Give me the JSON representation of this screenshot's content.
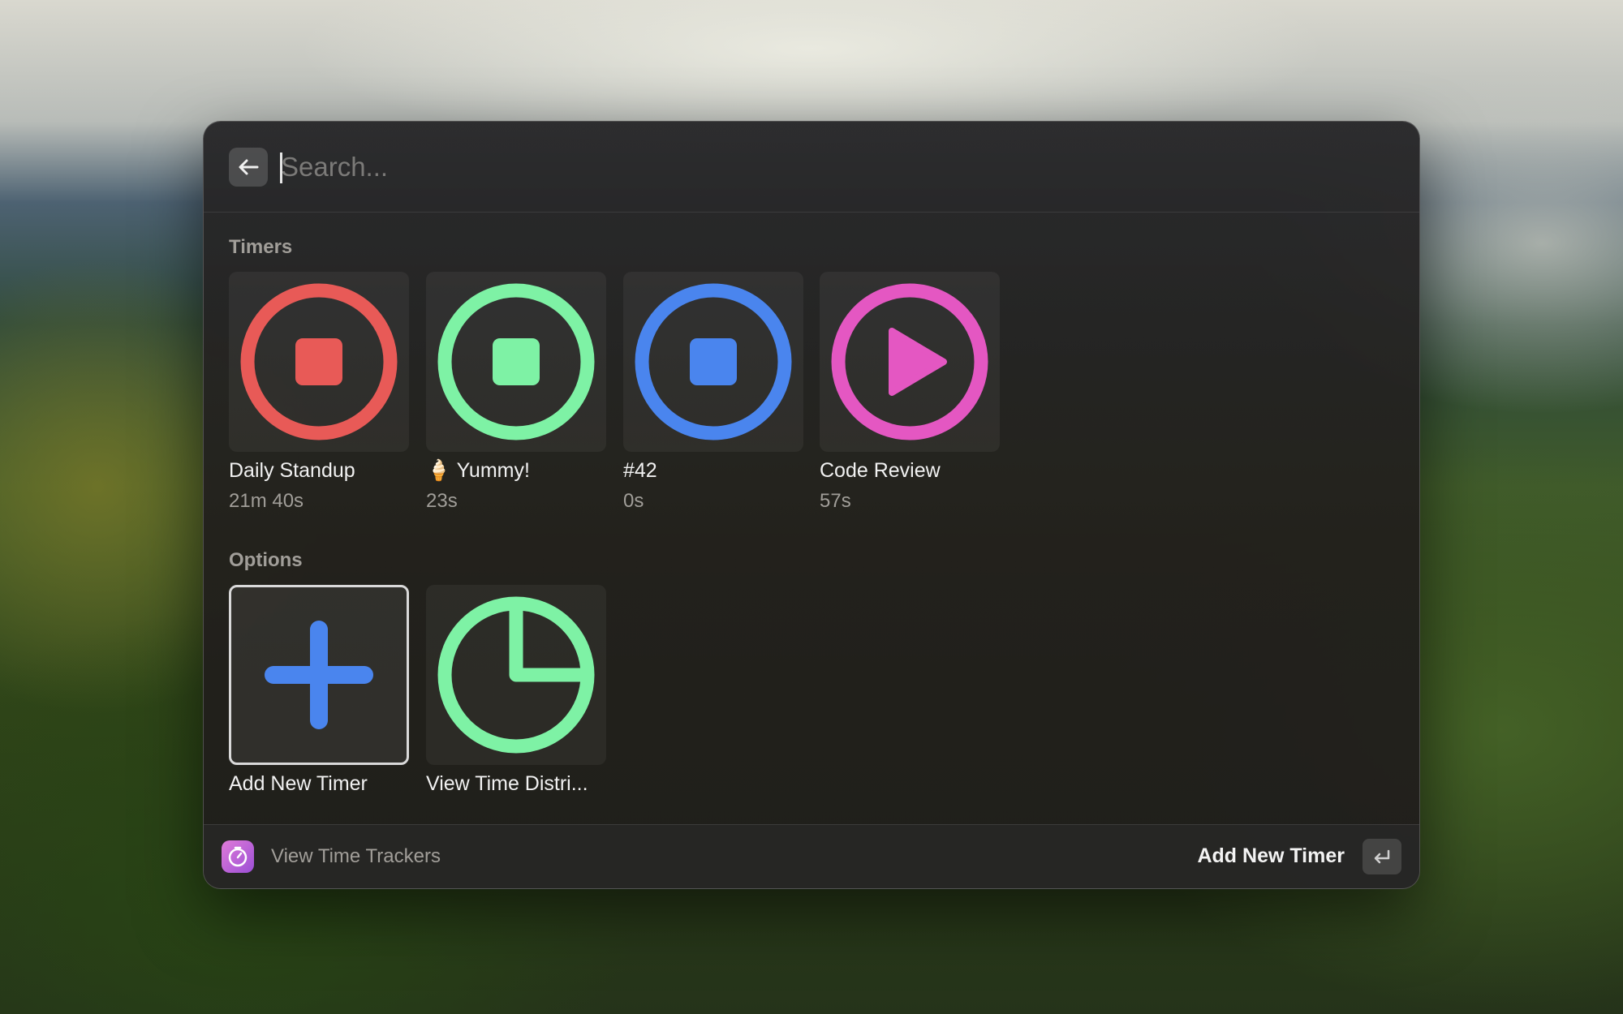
{
  "search": {
    "placeholder": "Search..."
  },
  "sections": {
    "timers_title": "Timers",
    "options_title": "Options"
  },
  "timers": [
    {
      "name": "Daily Standup",
      "elapsed": "21m 40s",
      "color": "#e85a57",
      "state": "stop-icon"
    },
    {
      "name": "🍦 Yummy!",
      "elapsed": "23s",
      "color": "#7ef2a5",
      "state": "stop-icon"
    },
    {
      "name": "#42",
      "elapsed": "0s",
      "color": "#4a85ee",
      "state": "stop-icon"
    },
    {
      "name": "Code Review",
      "elapsed": "57s",
      "color": "#e457c2",
      "state": "play-icon"
    }
  ],
  "options": [
    {
      "name": "Add New Timer",
      "icon": "plus-icon",
      "color": "#4a85ee",
      "selected": true
    },
    {
      "name": "View Time Distri...",
      "icon": "pie-chart-icon",
      "color": "#7ef2a5",
      "selected": false
    }
  ],
  "footer": {
    "app_label": "View Time Trackers",
    "primary_action": "Add New Timer",
    "app_icon": "stopwatch-icon",
    "enter_icon": "return-key-icon"
  }
}
